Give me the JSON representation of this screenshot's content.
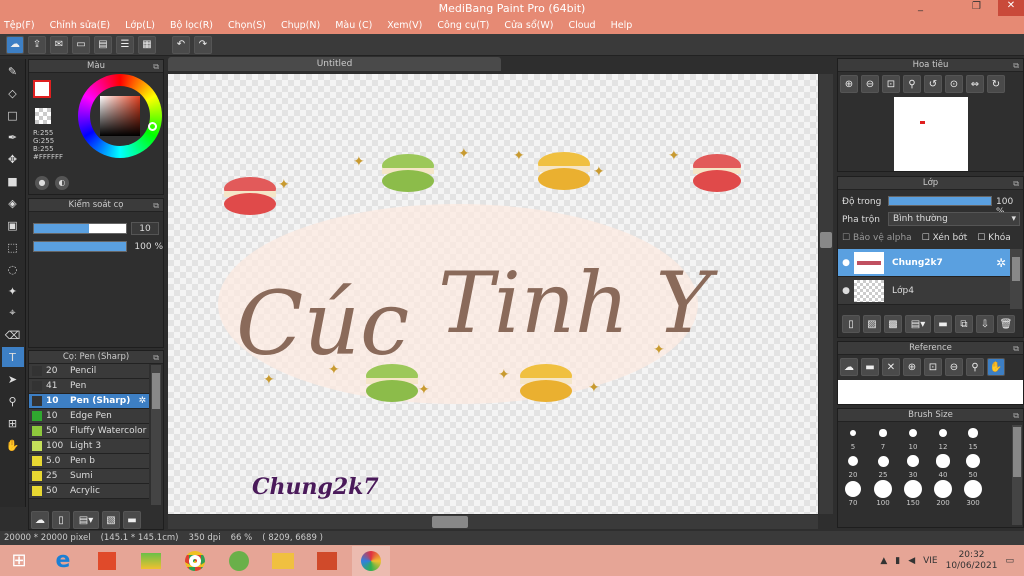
{
  "window": {
    "title": "MediBang Paint Pro (64bit)",
    "min": "_",
    "restore": "❐",
    "close": "✕"
  },
  "menu": [
    "Tệp(F)",
    "Chỉnh sửa(E)",
    "Lớp(L)",
    "Bộ lọc(R)",
    "Chọn(S)",
    "Chụp(N)",
    "Màu (C)",
    "Xem(V)",
    "Công cụ(T)",
    "Cửa sổ(W)",
    "Cloud",
    "Help"
  ],
  "color_panel": {
    "title": "Màu",
    "r": "R:255",
    "g": "G:255",
    "b": "B:255",
    "hex": "#FFFFFF"
  },
  "brush_control": {
    "title": "Kiểm soát cọ",
    "size": "10",
    "opacity": "100 %",
    "size_fill": 0.6,
    "opacity_fill": 1.0
  },
  "brush_list": {
    "title": "Cọ: Pen (Sharp)",
    "items": [
      {
        "size": "20",
        "name": "Pencil",
        "color": "#333333"
      },
      {
        "size": "41",
        "name": "Pen",
        "color": "#333333"
      },
      {
        "size": "10",
        "name": "Pen (Sharp)",
        "color": "#333333",
        "selected": true
      },
      {
        "size": "10",
        "name": "Edge Pen",
        "color": "#2fa82f"
      },
      {
        "size": "50",
        "name": "Fluffy Watercolor",
        "color": "#8ec83c"
      },
      {
        "size": "100",
        "name": "Light 3",
        "color": "#c5e05a"
      },
      {
        "size": "5.0",
        "name": "Pen b",
        "color": "#e8d832"
      },
      {
        "size": "25",
        "name": "Sumi",
        "color": "#e8d832"
      },
      {
        "size": "50",
        "name": "Acrylic",
        "color": "#e8d832"
      }
    ]
  },
  "document": {
    "tab": "Untitled",
    "art_text_1": "Cúc",
    "art_text_2": "Tinh Y",
    "signature": "Chung2k7"
  },
  "navigator": {
    "title": "Hoa tiêu"
  },
  "layers": {
    "title": "Lớp",
    "opacity_label": "Độ trong",
    "opacity_value": "100 %",
    "blend_label": "Pha trộn",
    "blend_value": "Bình thường",
    "protect_alpha": "Bảo vệ alpha",
    "clipping": "Xén bớt",
    "lock": "Khóa",
    "items": [
      {
        "name": "Chung2k7",
        "selected": true
      },
      {
        "name": "Lớp4",
        "selected": false
      }
    ]
  },
  "reference": {
    "title": "Reference"
  },
  "brush_size": {
    "title": "Brush Size",
    "values": [
      "5",
      "7",
      "10",
      "12",
      "15",
      "20",
      "25",
      "30",
      "40",
      "50",
      "70",
      "100",
      "150",
      "200",
      "300"
    ]
  },
  "status": {
    "size": "20000 * 20000 pixel",
    "cm": "(145.1 * 145.1cm)",
    "dpi": "350 dpi",
    "zoom": "66 %",
    "coords": "( 8209, 6689 )"
  },
  "taskbar": {
    "lang": "VIE",
    "time": "20:32",
    "date": "10/06/2021"
  },
  "colors": {
    "accent": "#3d7fc4",
    "titlebar": "#e68a74",
    "taskbar": "#e6a596"
  }
}
